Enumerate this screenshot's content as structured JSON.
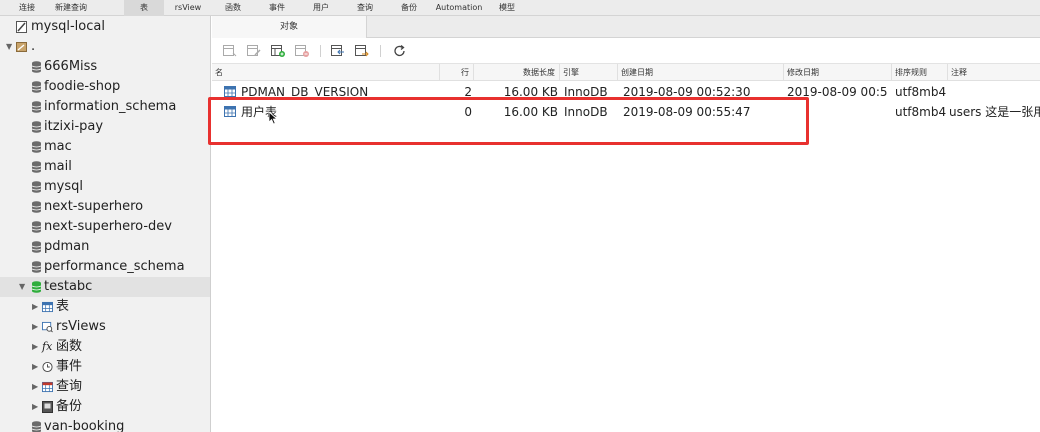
{
  "toolbar": {
    "items": [
      "连接",
      "新建查询",
      "表",
      "rsView",
      "函数",
      "事件",
      "用户",
      "查询",
      "备份",
      "Automation",
      "模型"
    ],
    "active_index": 2
  },
  "sidebar": {
    "connection": "mysql-local",
    "server_node": ".",
    "databases": [
      "666Miss",
      "foodie-shop",
      "information_schema",
      "itzixi-pay",
      "mac",
      "mail",
      "mysql",
      "next-superhero",
      "next-superhero-dev",
      "pdman",
      "performance_schema",
      "testabc"
    ],
    "open_database": "testabc",
    "children": [
      "表",
      "rsViews",
      "函数",
      "事件",
      "查询",
      "备份"
    ],
    "after": "van-booking"
  },
  "tab": {
    "label": "对象"
  },
  "grid": {
    "columns": [
      "名",
      "行",
      "数据长度",
      "引擎",
      "创建日期",
      "修改日期",
      "排序规则",
      "注释"
    ],
    "rows": [
      {
        "name": "PDMAN_DB_VERSION",
        "rows": "2",
        "data_length": "16.00 KB",
        "engine": "InnoDB",
        "created": "2019-08-09 00:52:30",
        "modified": "2019-08-09 00:5",
        "collation": "utf8mb4",
        "comment": ""
      },
      {
        "name": "用户表",
        "rows": "0",
        "data_length": "16.00 KB",
        "engine": "InnoDB",
        "created": "2019-08-09 00:55:47",
        "modified": "",
        "collation": "utf8mb4",
        "comment": "users 这是一张用户表"
      }
    ]
  },
  "colors": {
    "highlight": "#e8312f",
    "db_open": "#2fae3c"
  }
}
